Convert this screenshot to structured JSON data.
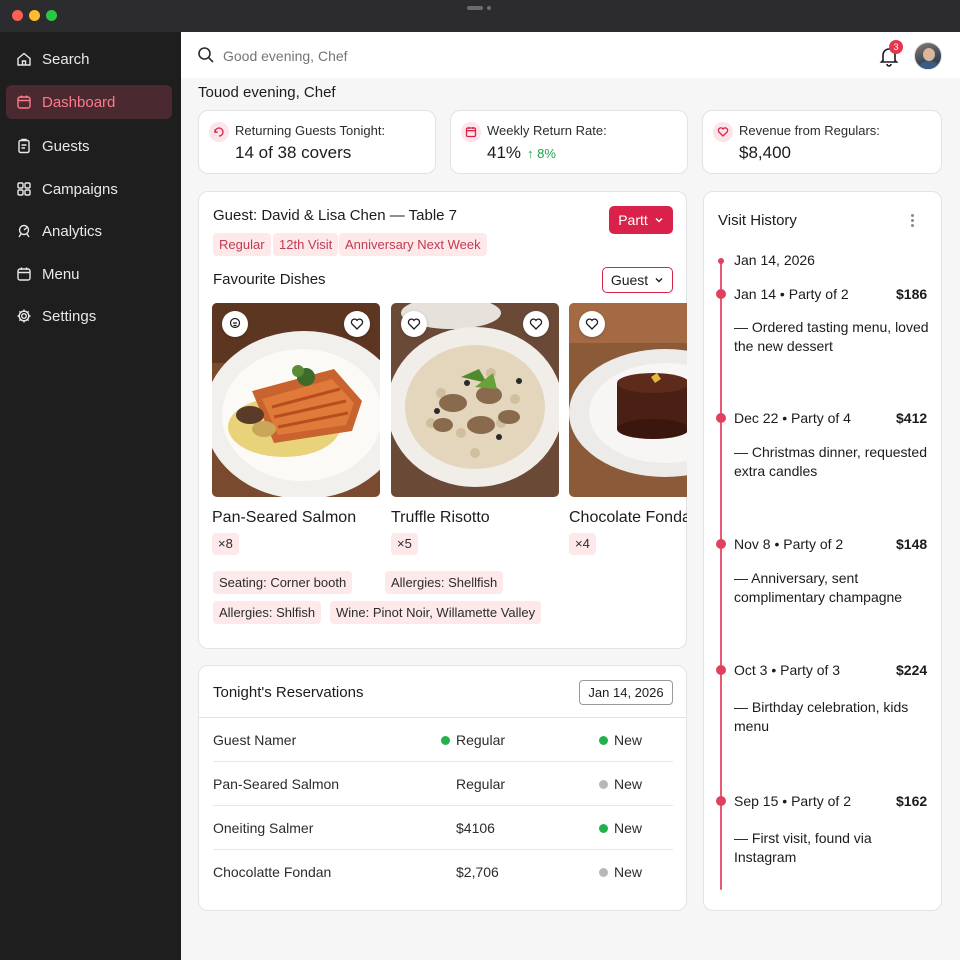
{
  "sidebar": {
    "items": [
      {
        "label": "Search",
        "icon": "home-icon"
      },
      {
        "label": "Dashboard",
        "icon": "calendar-icon",
        "active": true
      },
      {
        "label": "Guests",
        "icon": "clipboard-icon"
      },
      {
        "label": "Campaigns",
        "icon": "grid-icon"
      },
      {
        "label": "Analytics",
        "icon": "analytics-icon"
      },
      {
        "label": "Menu",
        "icon": "calendar-icon"
      },
      {
        "label": "Settings",
        "icon": "gear-icon"
      }
    ]
  },
  "topbar": {
    "search_placeholder": "Good evening, Chef",
    "notification_count": "3"
  },
  "greeting": "Touod evening, Chef",
  "stats": [
    {
      "label": "Returning Guests Tonight:",
      "value": "14 of 38 covers",
      "change": ""
    },
    {
      "label": "Weekly Return Rate:",
      "value": "41%",
      "change": "↑ 8%"
    },
    {
      "label": "Revenue from Regulars:",
      "value": "$8,400",
      "change": ""
    }
  ],
  "guest_card": {
    "title": "Guest: David & Lisa Chen — Table 7",
    "party_button": "Partt",
    "tags": [
      "Regular",
      "12th Visit",
      "Anniversary Next Week"
    ],
    "favourites_heading": "Favourite Dishes",
    "filter_label": "Guest",
    "dishes": [
      {
        "name": "Pan-Seared Salmon",
        "count": "×8"
      },
      {
        "name": "Truffle Risotto",
        "count": "×5"
      },
      {
        "name": "Chocolate Fondant",
        "count": "×4"
      }
    ],
    "notes": [
      "Seating: Corner booth",
      "Allergies: Shellfish",
      "Allergies: Shlfish",
      "Wine: Pinot Noir, Willamette Valley"
    ]
  },
  "reservations": {
    "title": "Tonight's Reservations",
    "date": "Jan 14, 2026",
    "rows": [
      {
        "name": "Guest Namer",
        "type": "Regular",
        "type_dot": "#22b24c",
        "status": "New",
        "status_dot": "#22b24c"
      },
      {
        "name": "Pan-Seared Salmon",
        "type": "Regular",
        "type_dot": "",
        "status": "New",
        "status_dot": "#b8b8bc"
      },
      {
        "name": "Oneiting Salmer",
        "type": "$4106",
        "type_dot": "",
        "status": "New",
        "status_dot": "#22b24c"
      },
      {
        "name": "Chocolatte Fondan",
        "type": "$2,706",
        "type_dot": "",
        "status": "New",
        "status_dot": "#b8b8bc"
      }
    ]
  },
  "visit_history": {
    "title": "Visit History",
    "start_date": "Jan 14, 2026",
    "visits": [
      {
        "date": "Jan 14",
        "party": "Party of 2",
        "amount": "$186",
        "note": "— Ordered tasting menu, loved the new dessert"
      },
      {
        "date": "Dec 22",
        "party": "Party of 4",
        "amount": "$412",
        "note": "— Christmas dinner, requested extra candles"
      },
      {
        "date": "Nov 8",
        "party": "Party of 2",
        "amount": "$148",
        "note": "— Anniversary, sent complimentary champagne"
      },
      {
        "date": "Oct 3",
        "party": "Party of 3",
        "amount": "$224",
        "note": "— Birthday celebration, kids menu"
      },
      {
        "date": "Sep 15",
        "party": "Party of 2",
        "amount": "$162",
        "note": "— First visit, found via Instagram"
      }
    ]
  },
  "colors": {
    "accent": "#d9214a",
    "sidebar_bg": "#1e1e1e",
    "active_bg": "#4a2a30",
    "positive": "#22a447"
  }
}
